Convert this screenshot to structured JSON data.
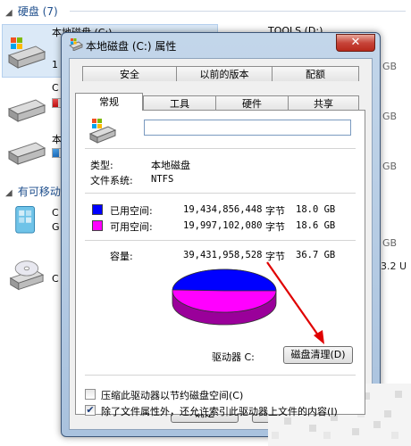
{
  "explorer": {
    "group_hard_disks": "硬盘 (7)",
    "group_removable": "有可移动",
    "drive1_name": "本地磁盘 (C:)",
    "drive1_right": "TOOLS (D:)",
    "drive_tags": [
      "1",
      "C",
      "本",
      "C",
      "C",
      "G",
      "C"
    ],
    "right_sizes": [
      "GB",
      "GB",
      "GB",
      "GB",
      "3.2 U"
    ],
    "drive_usage": [
      0.55,
      0.7,
      0.3
    ],
    "colors": {
      "bar": "#1e6fc0",
      "bar_full": "#c01010"
    }
  },
  "dialog": {
    "title": "本地磁盘 (C:) 属性",
    "close_label": "✕",
    "tabs_row1": [
      "安全",
      "以前的版本",
      "配额"
    ],
    "tabs_row2": [
      "常规",
      "工具",
      "硬件",
      "共享"
    ],
    "active_tab": "常规",
    "name_value": "",
    "type_label": "类型:",
    "type_value": "本地磁盘",
    "fs_label": "文件系统:",
    "fs_value": "NTFS",
    "used": {
      "label": "已用空间:",
      "bytes": "19,434,856,448",
      "unit": "字节",
      "size": "18.0 GB",
      "color": "#0000ff"
    },
    "free": {
      "label": "可用空间:",
      "bytes": "19,997,102,080",
      "unit": "字节",
      "size": "18.6 GB",
      "color": "#ff00ff"
    },
    "capacity": {
      "label": "容量:",
      "bytes": "39,431,958,528",
      "unit": "字节",
      "size": "36.7 GB"
    },
    "used_fraction": 0.493,
    "drive_label": "驱动器 C:",
    "cleanup_button": "磁盘清理(D)",
    "compress_label": "压缩此驱动器以节约磁盘空间(C)",
    "compress_checked": false,
    "index_label": "除了文件属性外，还允许索引此驱动器上文件的内容(I)",
    "index_checked": true,
    "ok_button": "确定",
    "cancel_button": "取消",
    "annotation_color": "#e00000"
  }
}
